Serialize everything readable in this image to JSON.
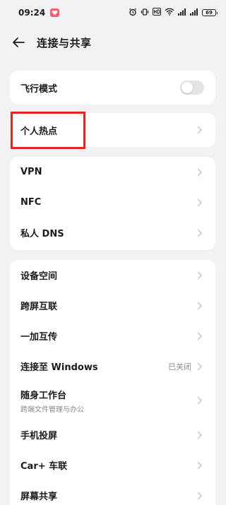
{
  "status_bar": {
    "time": "09:24",
    "battery": "69"
  },
  "header": {
    "title": "连接与共享"
  },
  "sections": {
    "airplane": {
      "label": "飞行模式",
      "enabled": false
    },
    "hotspot": {
      "label": "个人热点"
    },
    "network": [
      {
        "label": "VPN"
      },
      {
        "label": "NFC"
      },
      {
        "label": "私人 DNS"
      }
    ],
    "devices": [
      {
        "label": "设备空间"
      },
      {
        "label": "跨屏互联"
      },
      {
        "label": "一加互传"
      },
      {
        "label": "连接至 Windows",
        "status": "已关闭"
      },
      {
        "label": "随身工作台",
        "sublabel": "跨端文件管理与办公"
      },
      {
        "label": "手机投屏"
      },
      {
        "label": "Car+ 车联"
      },
      {
        "label": "屏幕共享"
      }
    ]
  },
  "colors": {
    "background": "#f2f2f4",
    "highlight": "#e8231e",
    "notif_badge": "#ff5a6e"
  }
}
